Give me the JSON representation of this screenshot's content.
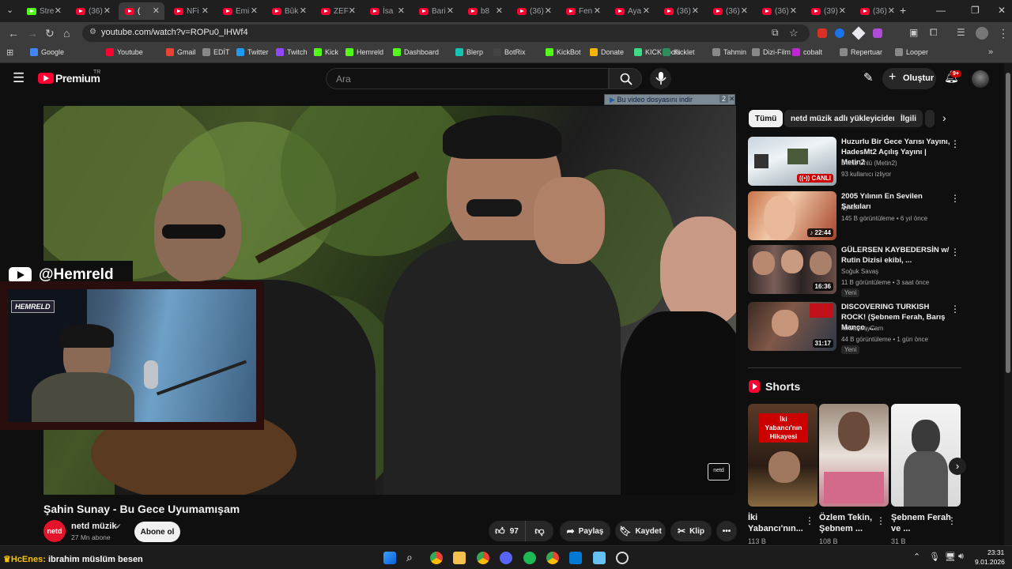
{
  "browser": {
    "tabs": [
      "Stre",
      "(36)",
      "(",
      "NFi",
      "Emi",
      "Bûk",
      "ZEF",
      "İsa",
      "Bari",
      "b8",
      "(36)",
      "Fen",
      "Aya",
      "(36)",
      "(36)",
      "(36)",
      "(39)",
      "(36)"
    ],
    "url": "youtube.com/watch?v=ROPu0_IHWf4",
    "bookmarks": [
      "Google",
      "Youtube",
      "Gmail",
      "EDİT",
      "Twitter",
      "Twitch",
      "Kick",
      "Hemreld",
      "Dashboard",
      "Blerp",
      "BotRix",
      "KickBot",
      "Donate",
      "KICK Tools",
      "Kicklet",
      "Tahmin",
      "Dizi-Film",
      "cobalt",
      "Repertuar",
      "Looper"
    ]
  },
  "youtube": {
    "logo": "Premium",
    "logo_sup": "TR",
    "search_placeholder": "Ara",
    "create_label": "Oluştur",
    "notif_count": "9+"
  },
  "video": {
    "download_bar": "Bu video dosyasını indir",
    "download_count": "2",
    "watermark": "netd",
    "title": "Şahin Sunay - Bu Gece Uyumamışam",
    "channel": "netd müzik",
    "subscribers": "27 Mn abone",
    "subscribe_label": "Abone ol",
    "likes": "97",
    "share_label": "Paylaş",
    "save_label": "Kaydet",
    "clip_label": "Klip",
    "channel_logo_text": "netd"
  },
  "overlay": {
    "handle": "@Hemreld",
    "cam_tag": "HEMRELD"
  },
  "sidebar": {
    "chips": [
      "Tümü",
      "netd müzik adlı yükleyiciden",
      "İlgili"
    ],
    "recs": [
      {
        "title": "Huzurlu Bir Gece Yarısı Yayını, HadesMt2 Açılış Yayını | Metin2",
        "channel": "Deniz Ünlü (Metin2)",
        "meta": "93 kullanıcı izliyor",
        "badge": "",
        "dur": "CANLI"
      },
      {
        "title": "2005 Yılının En Sevilen Şarkıları",
        "channel": "Aykan",
        "meta": "145 B görüntüleme • 6 yıl önce",
        "badge": "",
        "dur": "22:44"
      },
      {
        "title": "GÜLERSEN KAYBEDERSİN w/ Rutin Dizisi ekibi, ...",
        "channel": "Soğuk Savaş",
        "meta": "11 B görüntüleme • 3 saat önce",
        "badge": "Yeni",
        "dur": "16:36"
      },
      {
        "title": "DISCOVERING TURKISH ROCK! (Şebnem Ferah, Barış Manço, ...",
        "channel": "MrSammyCam",
        "meta": "44 B görüntüleme • 1 gün önce",
        "badge": "Yeni",
        "dur": "31:17"
      }
    ],
    "shorts_label": "Shorts",
    "shorts": [
      {
        "title": "İki Yabancı'nın...",
        "views": "113 B",
        "overlay": "İki Yabancı'nın Hikayesi"
      },
      {
        "title": "Özlem Tekin, Şebnem ...",
        "views": "108 B",
        "overlay": ""
      },
      {
        "title": "Şebnem Ferah ve ...",
        "views": "31 B",
        "overlay": ""
      }
    ]
  },
  "chat": {
    "user": "HcEnes:",
    "message": "ibrahim müslüm besen"
  },
  "system": {
    "time": "23:31",
    "date": "9.01.2026"
  }
}
